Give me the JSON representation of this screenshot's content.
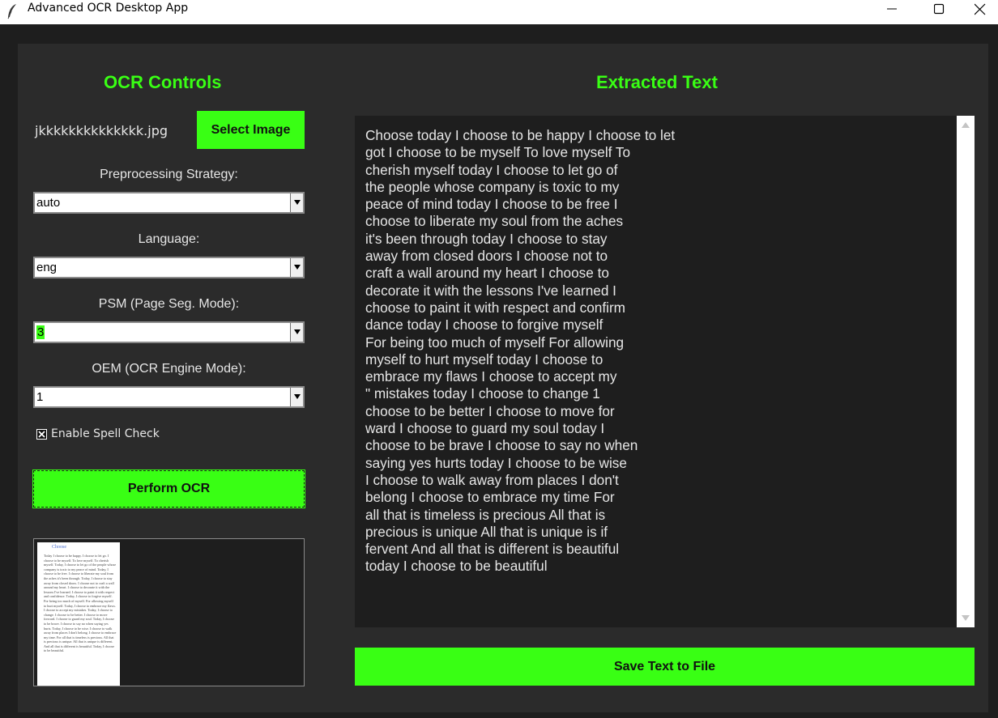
{
  "window": {
    "title": "Advanced OCR Desktop App"
  },
  "controls": {
    "heading": "OCR Controls",
    "filename": "jkkkkkkkkkkkkkk.jpg",
    "select_image_label": "Select Image",
    "preprocessing": {
      "label": "Preprocessing Strategy:",
      "value": "auto"
    },
    "language": {
      "label": "Language:",
      "value": "eng"
    },
    "psm": {
      "label": "PSM (Page Seg. Mode):",
      "value": "3"
    },
    "oem": {
      "label": "OEM (OCR Engine Mode):",
      "value": "1"
    },
    "spell_check": {
      "label": "Enable Spell Check",
      "checked": true
    },
    "perform_ocr_label": "Perform OCR",
    "preview": {
      "title": "Choose",
      "body": "Today I choose to be happy. I choose to let go. I choose to be myself. To love myself. To cherish myself. Today, I choose to let go of the people whose company is toxic to my peace of mind. Today, I choose to be free. I choose to liberate my soul from the aches it's been through. Today, I choose to stay away from closed doors. I choose not to craft a wall around my heart. I choose to decorate it with the lessons I've learned. I choose to paint it with respect and confidence. Today, I choose to forgive myself. For being too much of myself. For allowing myself to hurt myself. Today, I choose to embrace my flaws. I choose to accept my mistakes. Today, I choose to change. I choose to be better. I choose to move forward. I choose to guard my soul. Today, I choose to be brave. I choose to say no when saying yes hurts. Today, I choose to be wise. I choose to walk away from places I don't belong. I choose to embrace my time. For all that is timeless is precious. All that is precious is unique. All that is unique is different. And all that is different is beautiful. Today, I choose to be beautiful."
    }
  },
  "output": {
    "heading": "Extracted Text",
    "text": "Choose today I choose to be happy I choose to let\ngot I choose to be myself To love myself To\ncherish myself today I choose to let go of\nthe people whose company is toxic to my\npeace of mind today I choose to be free I\nchoose to liberate my soul from the aches\nit's been through today I choose to stay\naway from closed doors I choose not to\ncraft a wall around my heart I choose to\ndecorate it with the lessons I've learned I\nchoose to paint it with respect and confirm\ndance today I choose to forgive myself\nFor being too much of myself For allowing\nmyself to hurt myself today I choose to\nembrace my flaws I choose to accept my\n\" mistakes today I choose to change 1\nchoose to be better I choose to move for\nward I choose to guard my soul today I\nchoose to be brave I choose to say no when\nsaying yes hurts today I choose to be wise\nI choose to walk away from places I don't\nbelong I choose to embrace my time For\nall that is timeless is precious All that is\nprecious is unique All that is unique is if\nfervent And all that is different is beautiful\ntoday I choose to be beautiful",
    "save_label": "Save Text to File"
  },
  "colors": {
    "accent": "#39ff14",
    "panel": "#2b2b2b",
    "background": "#1e1e1e"
  }
}
